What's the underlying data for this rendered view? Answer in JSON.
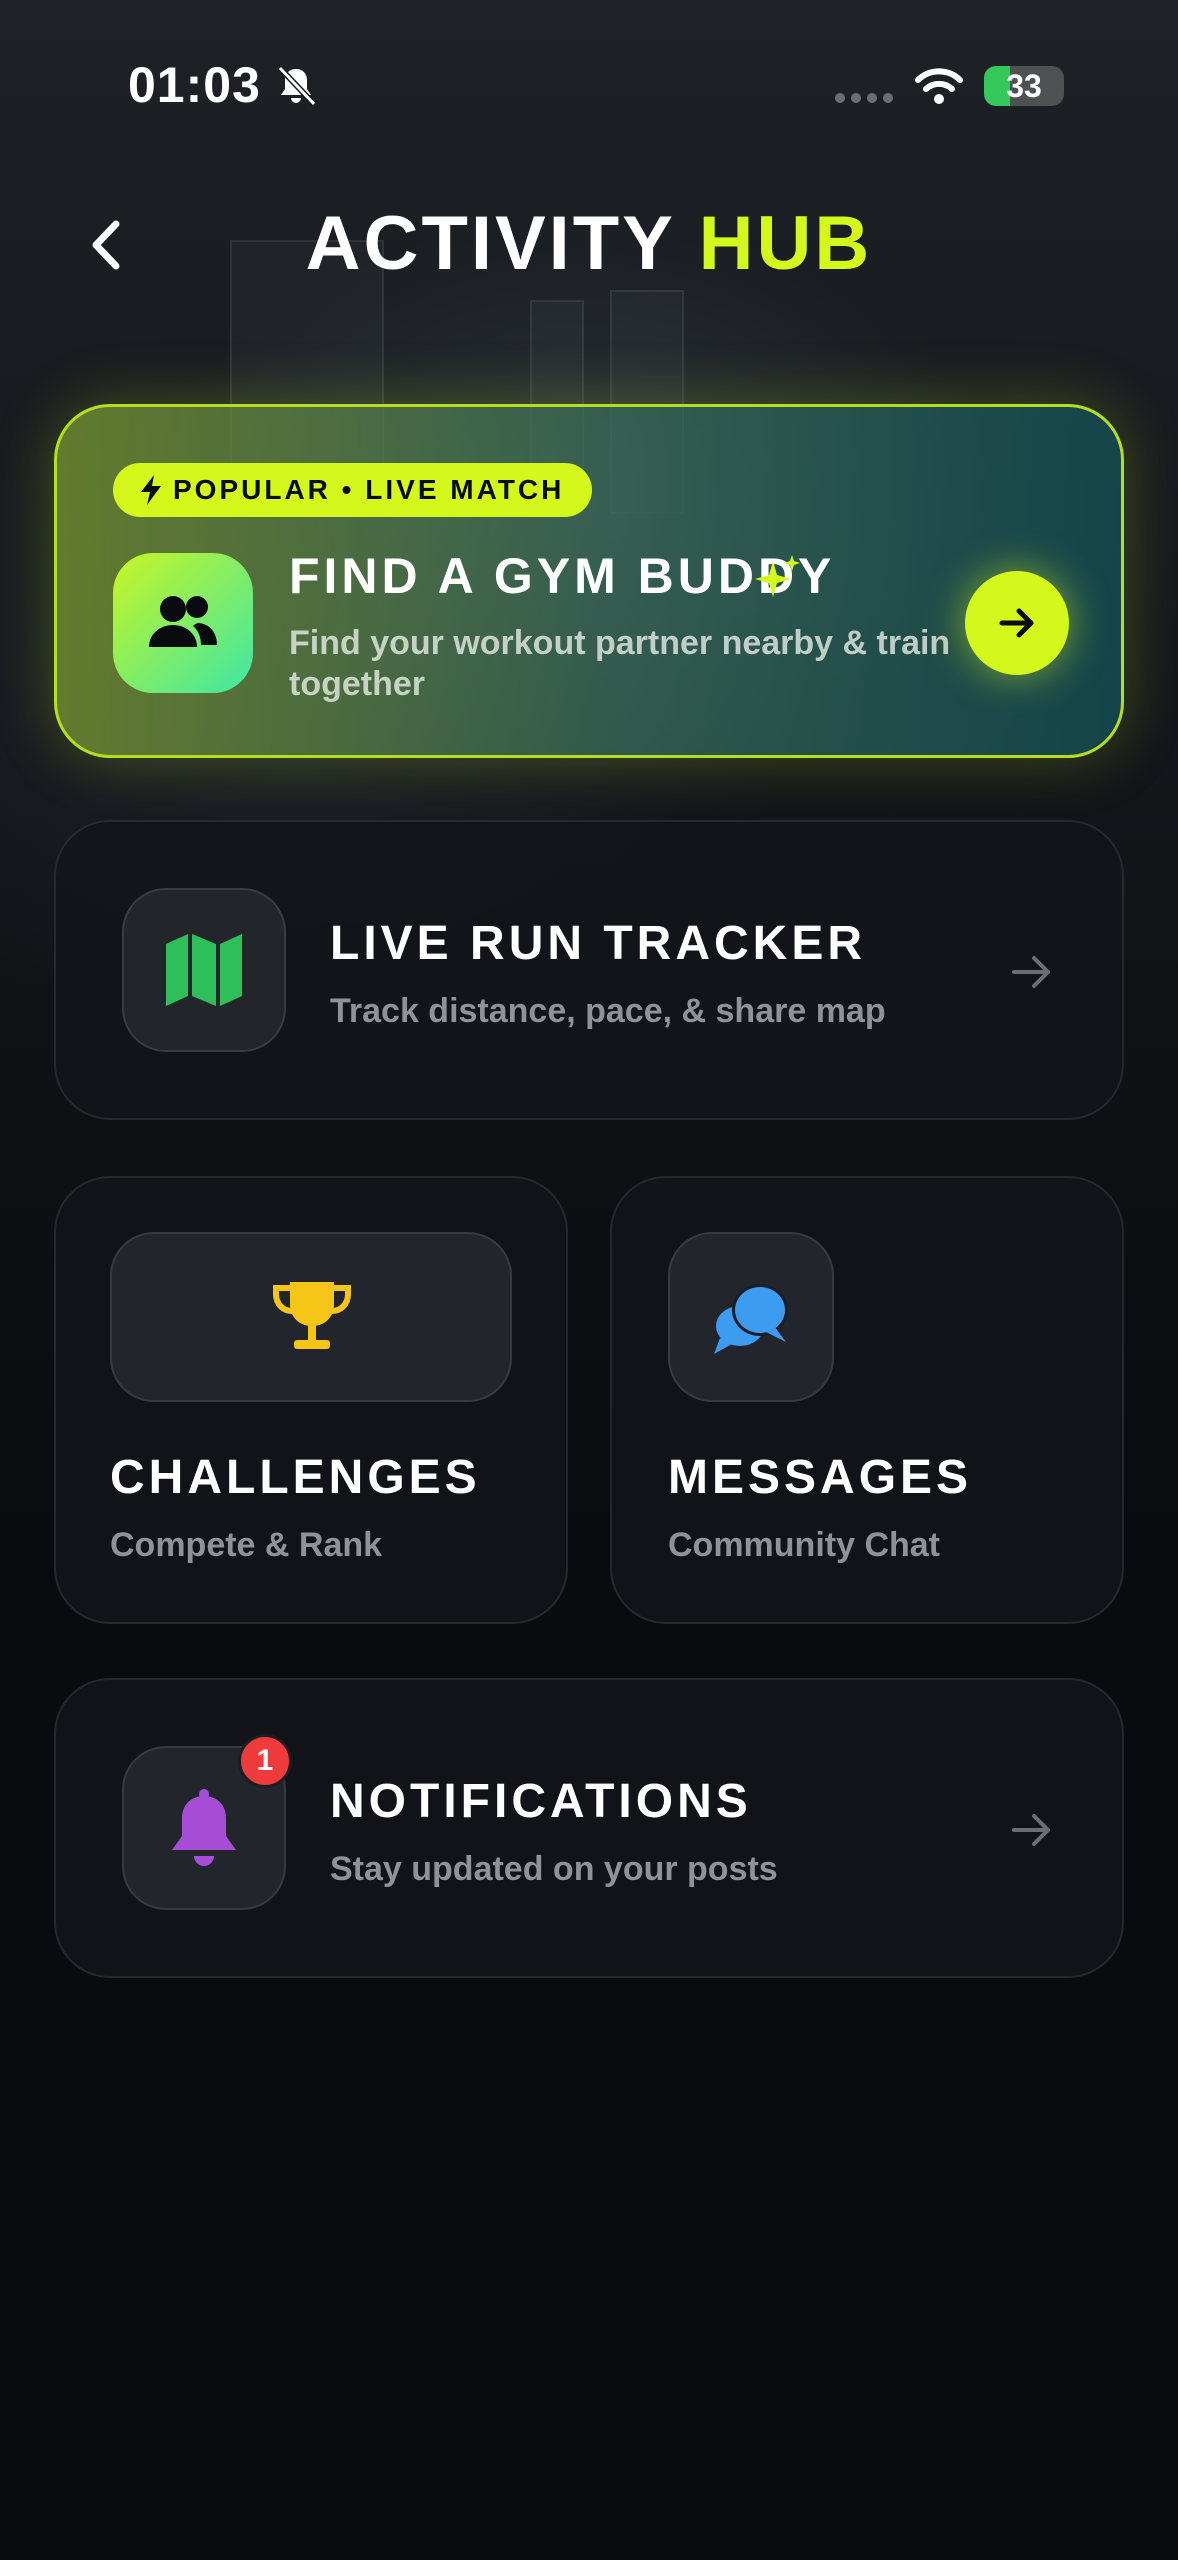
{
  "status_bar": {
    "time": "01:03",
    "battery_level": 33,
    "battery_text": "33"
  },
  "header": {
    "title_main": "ACTIVITY",
    "title_accent": "HUB",
    "accent_color": "#d4f81c"
  },
  "hero": {
    "badge": "POPULAR • LIVE MATCH",
    "title": "FIND A GYM BUDDY",
    "subtitle": "Find your workout partner nearby & train together",
    "icon": "people-icon",
    "sparkle_icon": "sparkles-icon"
  },
  "run_tracker": {
    "title": "LIVE RUN TRACKER",
    "subtitle": "Track distance, pace, & share map",
    "icon": "map-icon",
    "icon_color": "#2fbf5a"
  },
  "challenges": {
    "title": "CHALLENGES",
    "subtitle": "Compete & Rank",
    "icon": "trophy-icon",
    "icon_color": "#f5c518"
  },
  "messages": {
    "title": "MESSAGES",
    "subtitle": "Community Chat",
    "icon": "chat-bubbles-icon",
    "icon_color": "#3d9bf0"
  },
  "notifications": {
    "title": "NOTIFICATIONS",
    "subtitle": "Stay updated on your posts",
    "icon": "bell-icon",
    "icon_color": "#a64ed6",
    "badge_count": "1"
  }
}
